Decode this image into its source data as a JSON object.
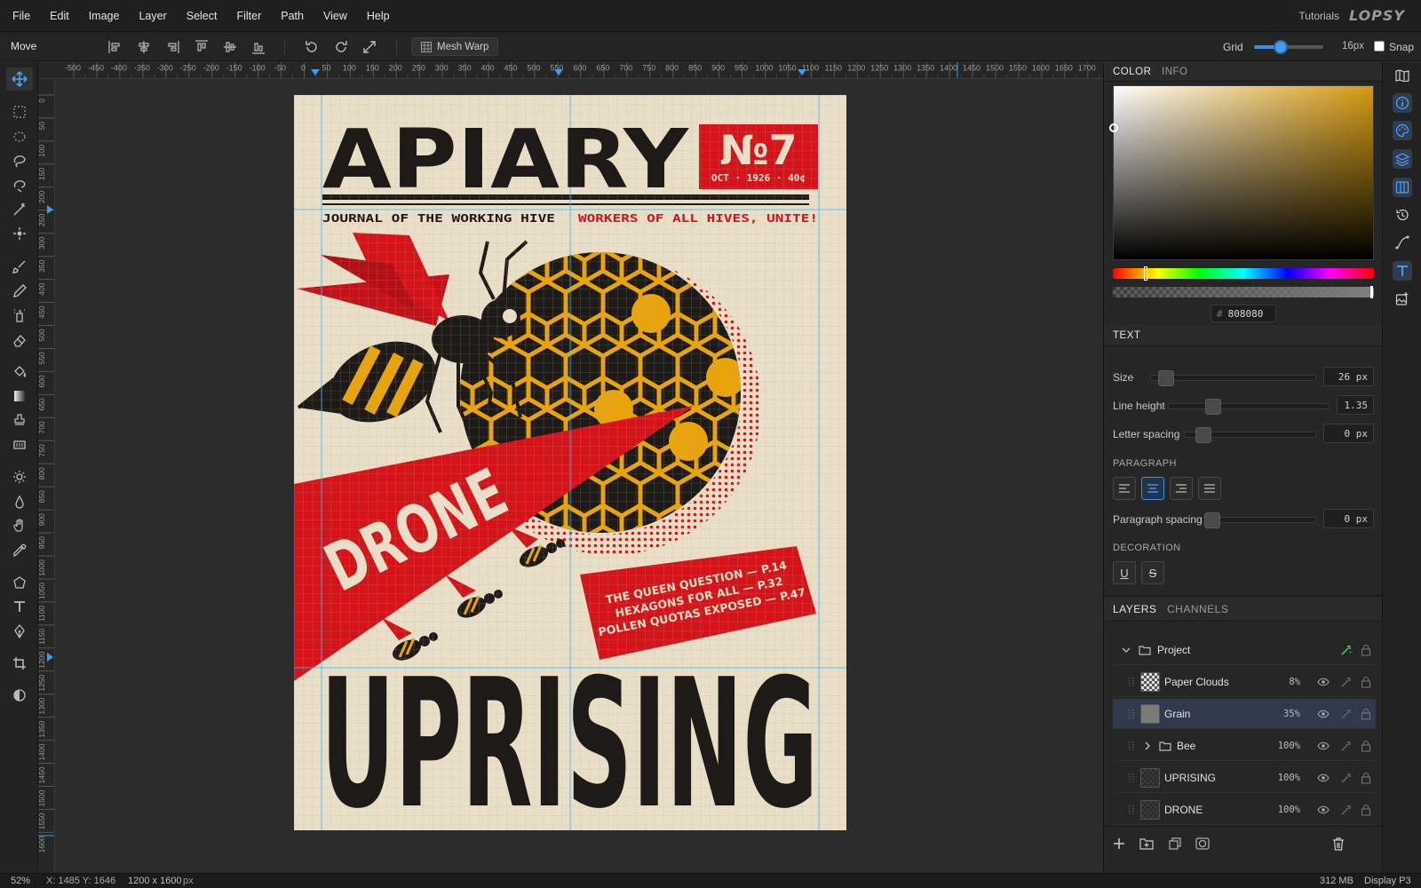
{
  "menu": {
    "items": [
      "File",
      "Edit",
      "Image",
      "Layer",
      "Select",
      "Filter",
      "Path",
      "View",
      "Help"
    ],
    "tutorials": "Tutorials",
    "brand": "LOPSY"
  },
  "options": {
    "tool_name": "Move",
    "mesh_warp": "Mesh Warp",
    "grid_label": "Grid",
    "grid_value": "16px",
    "grid_fraction": 0.38,
    "snap_label": "Snap",
    "snap_checked": false
  },
  "rulers": {
    "top_ticks": [
      "-500",
      "-450",
      "-400",
      "-350",
      "-300",
      "-250",
      "-200",
      "-150",
      "-100",
      "-50",
      "0",
      "50",
      "100",
      "150",
      "200",
      "250",
      "300",
      "350",
      "400",
      "450",
      "500",
      "550",
      "600",
      "650",
      "700",
      "750",
      "800",
      "850",
      "900",
      "950",
      "1000",
      "1050",
      "1100",
      "1150",
      "1200",
      "1250",
      "1300",
      "1350",
      "1400",
      "1450",
      "1500",
      "1550",
      "1600",
      "1650",
      "1700"
    ],
    "left_ticks": [
      "0",
      "50",
      "100",
      "150",
      "200",
      "250",
      "300",
      "350",
      "400",
      "450",
      "500",
      "550",
      "600",
      "650",
      "700",
      "750",
      "800",
      "850",
      "900",
      "950",
      "1000",
      "1050",
      "1100",
      "1150",
      "1200",
      "1250",
      "1300",
      "1350",
      "1400",
      "1450",
      "1500",
      "1550",
      "1600"
    ]
  },
  "poster": {
    "title": "APIARY",
    "issue": "№7",
    "issue_date": "OCT · 1926 · 40¢",
    "tagline_left": "JOURNAL OF THE WORKING HIVE",
    "tagline_right": "WORKERS OF ALL HIVES, UNITE!",
    "drone": "DRONE",
    "banner_lines": [
      "THE QUEEN QUESTION — P.14",
      "HEXAGONS FOR ALL — P.32",
      "POLLEN QUOTAS EXPOSED — P.47"
    ],
    "uprising": "UPRISING",
    "colors": {
      "paper": "#e9dfc8",
      "red": "#d4141a",
      "black": "#1e1a17",
      "gold": "#e9a40b"
    }
  },
  "color_panel": {
    "tabs": [
      "COLOR",
      "INFO"
    ],
    "hex": "808080",
    "hash": "#"
  },
  "text_panel": {
    "title": "TEXT",
    "size_label": "Size",
    "size_value": "26 px",
    "line_height_label": "Line height",
    "line_height_value": "1.35",
    "letter_spacing_label": "Letter spacing",
    "letter_spacing_value": "0 px",
    "paragraph_header": "PARAGRAPH",
    "paragraph_spacing_label": "Paragraph spacing",
    "paragraph_spacing_value": "0 px",
    "decoration_header": "DECORATION",
    "underline": "U",
    "strike": "S"
  },
  "layers_panel": {
    "tabs": [
      "LAYERS",
      "CHANNELS"
    ],
    "group": "Project",
    "layers": [
      {
        "name": "Paper Clouds",
        "opacity": "8%"
      },
      {
        "name": "Grain",
        "opacity": "35%"
      },
      {
        "name": "Bee",
        "opacity": "100%"
      },
      {
        "name": "UPRISING",
        "opacity": "100%"
      },
      {
        "name": "DRONE",
        "opacity": "100%"
      }
    ]
  },
  "status": {
    "zoom": "52%",
    "cursor": "X: 1485 Y: 1646",
    "dimensions": "1200 x 1600",
    "unit": "px",
    "memory": "312 MB",
    "color_profile": "Display P3"
  }
}
